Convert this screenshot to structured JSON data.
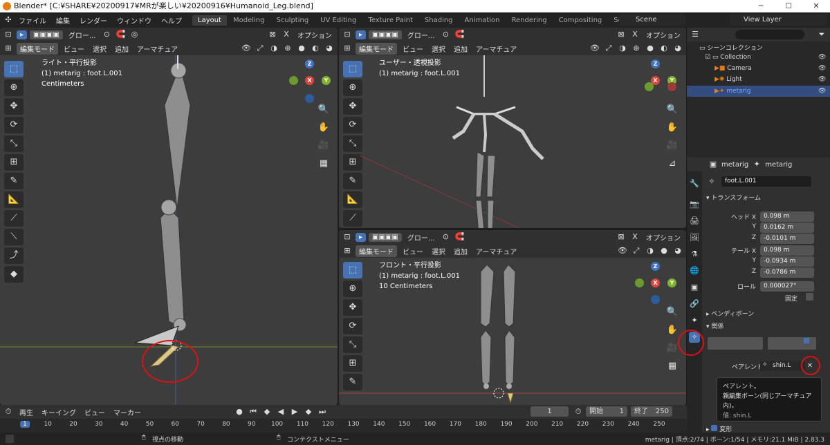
{
  "window": {
    "title": "Blender* [C:¥SHARE¥20200917¥MRが楽しい¥20200916¥Humanoid_Leg.blend]"
  },
  "menu": {
    "items": [
      "ファイル",
      "編集",
      "レンダー",
      "ウィンドウ",
      "ヘルプ"
    ]
  },
  "workspaces": [
    "Layout",
    "Modeling",
    "Sculpting",
    "UV Editing",
    "Texture Paint",
    "Shading",
    "Animation",
    "Rendering",
    "Compositing",
    "Scripting"
  ],
  "scene": {
    "name": "Scene",
    "view_layer": "View Layer"
  },
  "viewport_header": {
    "global": "グロー...",
    "options": "オプション",
    "mode": "編集モード",
    "view": "ビュー",
    "select": "選択",
    "add": "追加",
    "armature": "アーマチュア"
  },
  "viewports": {
    "left": {
      "line1": "ライト・平行投影",
      "line2": "(1) metarig : foot.L.001",
      "line3": "Centimeters"
    },
    "top_right": {
      "line1": "ユーザー・透視投影",
      "line2": "(1) metarig : foot.L.001"
    },
    "bottom_right": {
      "line1": "フロント・平行投影",
      "line2": "(1) metarig : foot.L.001",
      "line3": "10 Centimeters"
    }
  },
  "axis_labels": {
    "x": "X",
    "y": "Y",
    "z": "Z"
  },
  "outliner": {
    "title": "シーンコレクション",
    "items": [
      {
        "label": "Collection"
      },
      {
        "label": "Camera"
      },
      {
        "label": "Light"
      },
      {
        "label": "metarig"
      }
    ]
  },
  "properties": {
    "breadcrumb_object": "metarig",
    "breadcrumb_data": "metarig",
    "bone_name": "foot.L.001",
    "transform_title": "トランスフォーム",
    "head_label": "ヘッド X",
    "tail_label": "テール X",
    "y_label": "Y",
    "z_label": "Z",
    "head": [
      "0.098 m",
      "0.0162 m",
      "-0.0101 m"
    ],
    "tail": [
      "0.098 m",
      "-0.0934 m",
      "-0.0786 m"
    ],
    "roll_label": "ロール",
    "roll": "0.000027°",
    "lock_label": "固定",
    "bendy_title": "ベンディボーン",
    "relations_title": "関係",
    "parent_label": "ペアレント",
    "parent_value": "shin.L",
    "deform_title": "変形"
  },
  "tooltip": {
    "line1": "ペアレント。",
    "line2": "親編集ボーン(同じアーマチュア内)。",
    "line3": "値: shin.L"
  },
  "timeline": {
    "playback": "再生",
    "keying": "キーイング",
    "view": "ビュー",
    "marker": "マーカー",
    "current_frame": "1",
    "start_label": "開始",
    "start": "1",
    "end_label": "終了",
    "end": "250",
    "ruler": [
      "1",
      "10",
      "20",
      "30",
      "40",
      "50",
      "60",
      "70",
      "80",
      "90",
      "100",
      "110",
      "120",
      "130",
      "140",
      "150",
      "160",
      "170",
      "180",
      "190",
      "200",
      "210",
      "220",
      "230",
      "240",
      "250"
    ]
  },
  "statusbar": {
    "left": "視点の移動",
    "middle": "コンテクストメニュー",
    "right": "metarig | 頂点:2/74 | ボーン:1/54 | メモリ:21.1 MiB | 2.83.3"
  }
}
